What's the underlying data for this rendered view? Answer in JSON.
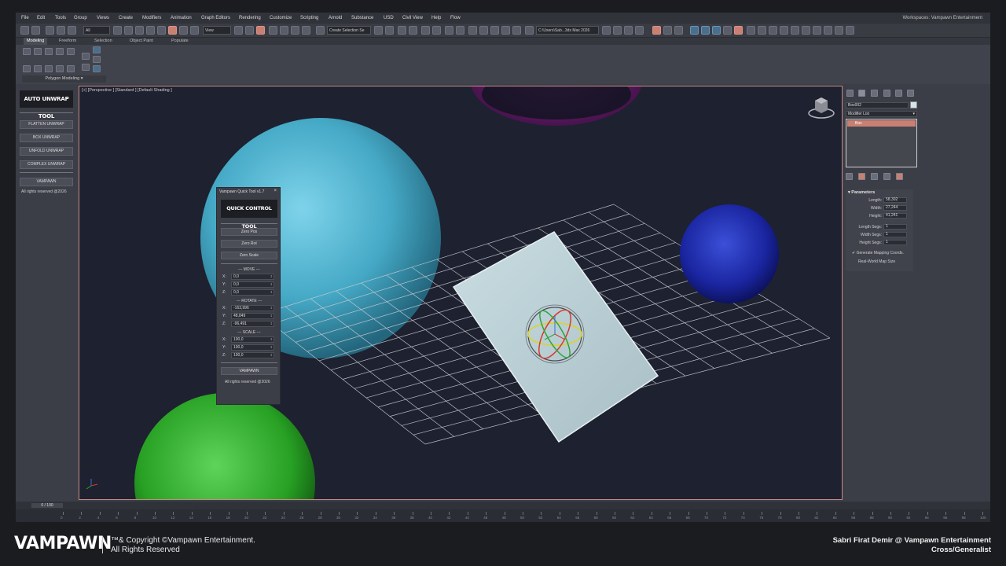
{
  "menu": [
    "File",
    "Edit",
    "Tools",
    "Group",
    "Views",
    "Create",
    "Modifiers",
    "Animation",
    "Graph Editors",
    "Rendering",
    "Customize",
    "Scripting",
    "Arnold",
    "Substance",
    "USD",
    "Civil View",
    "Help",
    "Flow"
  ],
  "workspace": "Workspaces: Vampawn Entertainment",
  "toolbar": {
    "filter_select": "All",
    "view_select": "View",
    "selection_set": "Create Selection Se",
    "project_path": "C:\\Users\\Sab...3ds Max 2026"
  },
  "ribbon": {
    "tabs": [
      "Modeling",
      "Freeform",
      "Selection",
      "Object Paint",
      "Populate"
    ],
    "active_tab": "Modeling",
    "panel_label": "Polygon Modeling"
  },
  "left_panel": {
    "title": "AUTO UNWRAP TOOL",
    "buttons": [
      "FLATTEN UNWRAP",
      "BOX UNWRAP",
      "UNFOLD UNWRAP",
      "COMPLEX UNWRAP"
    ],
    "brand_button": "VAMPAWN",
    "rights": "All rights reserved @2026"
  },
  "viewport": {
    "label": "[+] [Perspective ] [Standard ] [Default Shading ]"
  },
  "quick_tool": {
    "window_title": "Vampawn Quick Tool v1.7",
    "close": "×",
    "title": "QUICK CONTROL TOOL",
    "buttons": [
      "Zero Pos",
      "Zero Rot",
      "Zero Scale"
    ],
    "move_label": "--- MOVE ---",
    "rotate_label": "--- ROTATE ---",
    "scale_label": "--- SCALE ---",
    "axes": [
      "X:",
      "Y:",
      "Z:"
    ],
    "move": [
      "0,0",
      "0,0",
      "0,0"
    ],
    "rotate": [
      "-163,996",
      "48,849",
      "-96,491"
    ],
    "scale": [
      "100,0",
      "100,0",
      "100,0"
    ],
    "brand_button": "VAMPAWN",
    "rights": "All rights reserved @2026"
  },
  "command_panel": {
    "object_name": "Box002",
    "object_color": "#d7e4ea",
    "modifier_list": "Modifier List",
    "stack": [
      "Box"
    ],
    "params_title": "Parameters",
    "params": [
      {
        "label": "Length:",
        "value": "58,302"
      },
      {
        "label": "Width:",
        "value": "27,244"
      },
      {
        "label": "Height:",
        "value": "41,241"
      },
      {
        "label": "Length Segs:",
        "value": "1"
      },
      {
        "label": "Width Segs:",
        "value": "1"
      },
      {
        "label": "Height Segs:",
        "value": "1"
      }
    ],
    "gen_mapping": "Generate Mapping Coords.",
    "real_world": "Real-World Map Size"
  },
  "timeline": {
    "slider": "0 / 100",
    "ticks": [
      "0",
      "2",
      "4",
      "6",
      "8",
      "10",
      "12",
      "14",
      "16",
      "18",
      "20",
      "22",
      "24",
      "26",
      "28",
      "30",
      "32",
      "34",
      "36",
      "38",
      "40",
      "42",
      "44",
      "46",
      "48",
      "50",
      "52",
      "54",
      "56",
      "58",
      "60",
      "62",
      "64",
      "66",
      "68",
      "70",
      "72",
      "74",
      "76",
      "78",
      "80",
      "82",
      "84",
      "86",
      "88",
      "90",
      "92",
      "94",
      "96",
      "98",
      "100"
    ]
  },
  "footer": {
    "brand": "VAMPAWN",
    "copyright_line1": "™& Copyright ©Vampawn Entertainment.",
    "copyright_line2": "All Rights Reserved",
    "credit_line1": "Sabri Firat Demir @ Vampawn Entertainment",
    "credit_line2": "Cross/Generalist"
  },
  "colors": {
    "accent": "#c97f72",
    "viewport_bg": "#1e2130",
    "sphere_cyan": "#4fb3d0",
    "sphere_blue": "#1f2fa8",
    "sphere_green": "#2ea82a",
    "sphere_purple": "#6a1a6e",
    "box": "#b8cfd4"
  }
}
